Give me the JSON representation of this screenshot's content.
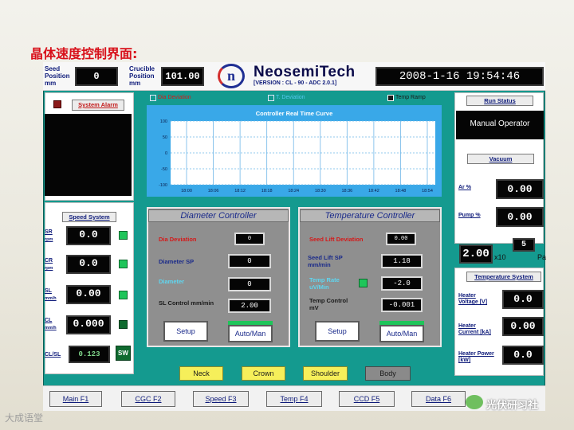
{
  "slide_title": "晶体速度控制界面:",
  "header": {
    "seed_position_label": "Seed Position mm",
    "seed_position_value": "0",
    "crucible_position_label": "Crucible Position mm",
    "crucible_position_value": "101.00",
    "brand": "NeosemiTech",
    "version": "[VERSION : CL - 90 - ADC 2.0.1]",
    "logo_glyph": "n",
    "datetime": "2008-1-16 19:54:46"
  },
  "left": {
    "system_alarm_label": "System Alarm",
    "speed_system_label": "Speed System",
    "speeds": [
      {
        "label": "SR",
        "unit": "rpm",
        "value": "0.0"
      },
      {
        "label": "CR",
        "unit": "rpm",
        "value": "0.0"
      },
      {
        "label": "SL",
        "unit": "mm/h",
        "value": "0.00"
      },
      {
        "label": "CL",
        "unit": "mm/h",
        "value": "0.000"
      }
    ],
    "clsl_label": "CL/SL",
    "clsl_value": "0.123",
    "sw_label": "SW"
  },
  "checkboxes": {
    "dia_deviation": "Dia Deviation",
    "t_deviation": "T. Deviation",
    "temp_ramp": "Temp Ramp"
  },
  "chart_data": {
    "type": "line",
    "title": "Controller Real Time Curve",
    "x_ticks": [
      "18:00",
      "18:06",
      "18:12",
      "18:18",
      "18:24",
      "18:30",
      "18:36",
      "18:42",
      "18:48",
      "18:54"
    ],
    "y_ticks": [
      "100",
      "50",
      "0",
      "-50",
      "-100"
    ],
    "ylim": [
      -100,
      100
    ],
    "grid": true,
    "series": []
  },
  "diameter_controller": {
    "title": "Diameter Controller",
    "dia_deviation_label": "Dia Deviation",
    "dia_deviation_value": "0",
    "diameter_sp_label": "Diameter SP",
    "diameter_sp_value": "0",
    "diameter_label": "Diameter",
    "diameter_value": "0",
    "sl_control_label": "SL Control mm/min",
    "sl_control_value": "2.00",
    "setup_label": "Setup",
    "auto_man_label": "Auto/Man"
  },
  "temperature_controller": {
    "title": "Temperature Controller",
    "seed_lift_dev_label": "Seed Lift Deviation",
    "seed_lift_dev_value": "0.00",
    "seed_lift_sp_label": "Seed Lift SP mm/min",
    "seed_lift_sp_value": "1.18",
    "temp_rate_label": "Temp Rate uV/Min",
    "temp_rate_value": "-2.0",
    "temp_control_label": "Temp Control mV",
    "temp_control_value": "-0.001",
    "setup_label": "Setup",
    "auto_man_label": "Auto/Man"
  },
  "stages": [
    "Neck",
    "Crown",
    "Shoulder",
    "Body"
  ],
  "right": {
    "run_status_label": "Run Status",
    "run_status_value": "Manual Operator",
    "vacuum_label": "Vacuum",
    "ar_label": "Ar %",
    "ar_value": "0.00",
    "pump_label": "Pump %",
    "pump_value": "0.00",
    "pressure_mantissa": "2.00",
    "pressure_x10": "x10",
    "pressure_exp": "5",
    "pressure_unit": "Pa",
    "temperature_system_label": "Temperature System",
    "temps": [
      {
        "label": "Heater Voltage [V]",
        "value": "0.0"
      },
      {
        "label": "Heater Current [kA]",
        "value": "0.00"
      },
      {
        "label": "Heater Power [kW]",
        "value": "0.0"
      }
    ]
  },
  "footer_buttons": [
    "Main F1",
    "CGC F2",
    "Speed F3",
    "Temp F4",
    "CCD F5",
    "Data F6"
  ],
  "watermark_left": "大成语堂",
  "watermark_right": "光伏研习社",
  "colors": {
    "frame_teal": "#149a8f",
    "chart_blue": "#39a8e8",
    "led_green": "#1fc55a",
    "title_red": "#d8101a",
    "label_navy": "#0e1b7a",
    "stage_yellow": "#f6ef5a"
  }
}
